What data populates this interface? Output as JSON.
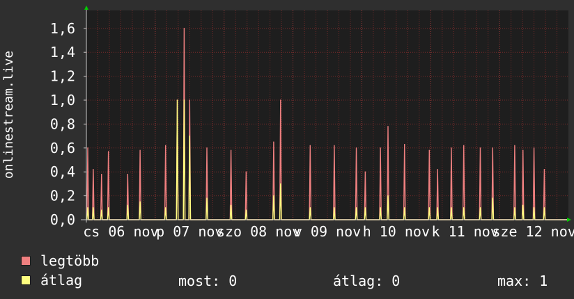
{
  "chart_data": {
    "type": "line",
    "ylabel": "onlinestream.live",
    "ylim": [
      0,
      1.75
    ],
    "y_ticks": [
      0,
      0.2,
      0.4,
      0.6,
      0.8,
      1.0,
      1.2,
      1.4,
      1.6
    ],
    "y_tick_labels": [
      "0,0",
      "0,2",
      "0,4",
      "0,6",
      "0,8",
      "1,0",
      "1,2",
      "1,4",
      "1,6"
    ],
    "x_range": [
      0,
      7
    ],
    "x_tick_labels": [
      "cs 06 nov",
      "p 07 nov",
      "szo 08 nov",
      "v 09 nov",
      "h 10 nov",
      "k 11 nov",
      "sze 12 nov"
    ],
    "grid": true,
    "colors": {
      "background": "#2f2f2f",
      "plot_bg": "#1e1e1e",
      "grid": "#7a2a2a",
      "axis": "#c8c8c8",
      "arrow": "#00cc00",
      "max_series": "#f08080",
      "avg_series": "#ffff80"
    },
    "series": [
      {
        "name": "legtöbb",
        "color": "#f08080",
        "points": [
          [
            0.02,
            0.6
          ],
          [
            0.1,
            0.42
          ],
          [
            0.22,
            0.38
          ],
          [
            0.32,
            0.57
          ],
          [
            0.6,
            0.38
          ],
          [
            0.78,
            0.58
          ],
          [
            1.15,
            0.62
          ],
          [
            1.32,
            1.0
          ],
          [
            1.42,
            1.6
          ],
          [
            1.5,
            1.0
          ],
          [
            1.75,
            0.6
          ],
          [
            2.1,
            0.58
          ],
          [
            2.32,
            0.4
          ],
          [
            2.72,
            0.65
          ],
          [
            2.82,
            1.0
          ],
          [
            3.25,
            0.62
          ],
          [
            3.6,
            0.62
          ],
          [
            3.92,
            0.6
          ],
          [
            4.05,
            0.4
          ],
          [
            4.27,
            0.6
          ],
          [
            4.38,
            0.78
          ],
          [
            4.62,
            0.63
          ],
          [
            4.98,
            0.58
          ],
          [
            5.1,
            0.42
          ],
          [
            5.3,
            0.6
          ],
          [
            5.48,
            0.62
          ],
          [
            5.72,
            0.6
          ],
          [
            5.9,
            0.6
          ],
          [
            6.22,
            0.62
          ],
          [
            6.34,
            0.58
          ],
          [
            6.5,
            0.6
          ],
          [
            6.65,
            0.42
          ],
          [
            6.88,
            0.0
          ]
        ]
      },
      {
        "name": "átlag",
        "color": "#ffff80",
        "points": [
          [
            0.02,
            0.1
          ],
          [
            0.1,
            0.1
          ],
          [
            0.22,
            0.08
          ],
          [
            0.32,
            0.1
          ],
          [
            0.6,
            0.12
          ],
          [
            0.78,
            0.15
          ],
          [
            1.15,
            0.1
          ],
          [
            1.32,
            1.0
          ],
          [
            1.42,
            1.0
          ],
          [
            1.5,
            0.7
          ],
          [
            1.75,
            0.18
          ],
          [
            2.1,
            0.12
          ],
          [
            2.32,
            0.08
          ],
          [
            2.72,
            0.2
          ],
          [
            2.82,
            0.3
          ],
          [
            3.25,
            0.1
          ],
          [
            3.6,
            0.1
          ],
          [
            3.92,
            0.1
          ],
          [
            4.05,
            0.1
          ],
          [
            4.27,
            0.1
          ],
          [
            4.38,
            0.2
          ],
          [
            4.62,
            0.1
          ],
          [
            4.98,
            0.1
          ],
          [
            5.1,
            0.1
          ],
          [
            5.3,
            0.1
          ],
          [
            5.48,
            0.1
          ],
          [
            5.72,
            0.1
          ],
          [
            5.9,
            0.18
          ],
          [
            6.22,
            0.1
          ],
          [
            6.34,
            0.12
          ],
          [
            6.5,
            0.1
          ],
          [
            6.65,
            0.1
          ],
          [
            6.88,
            0.0
          ]
        ]
      }
    ]
  },
  "legend": {
    "max_label": "legtöbb",
    "avg_label": "átlag"
  },
  "stats": {
    "most": "most: 0",
    "atlag": "átlag: 0",
    "max": "max: 1"
  }
}
